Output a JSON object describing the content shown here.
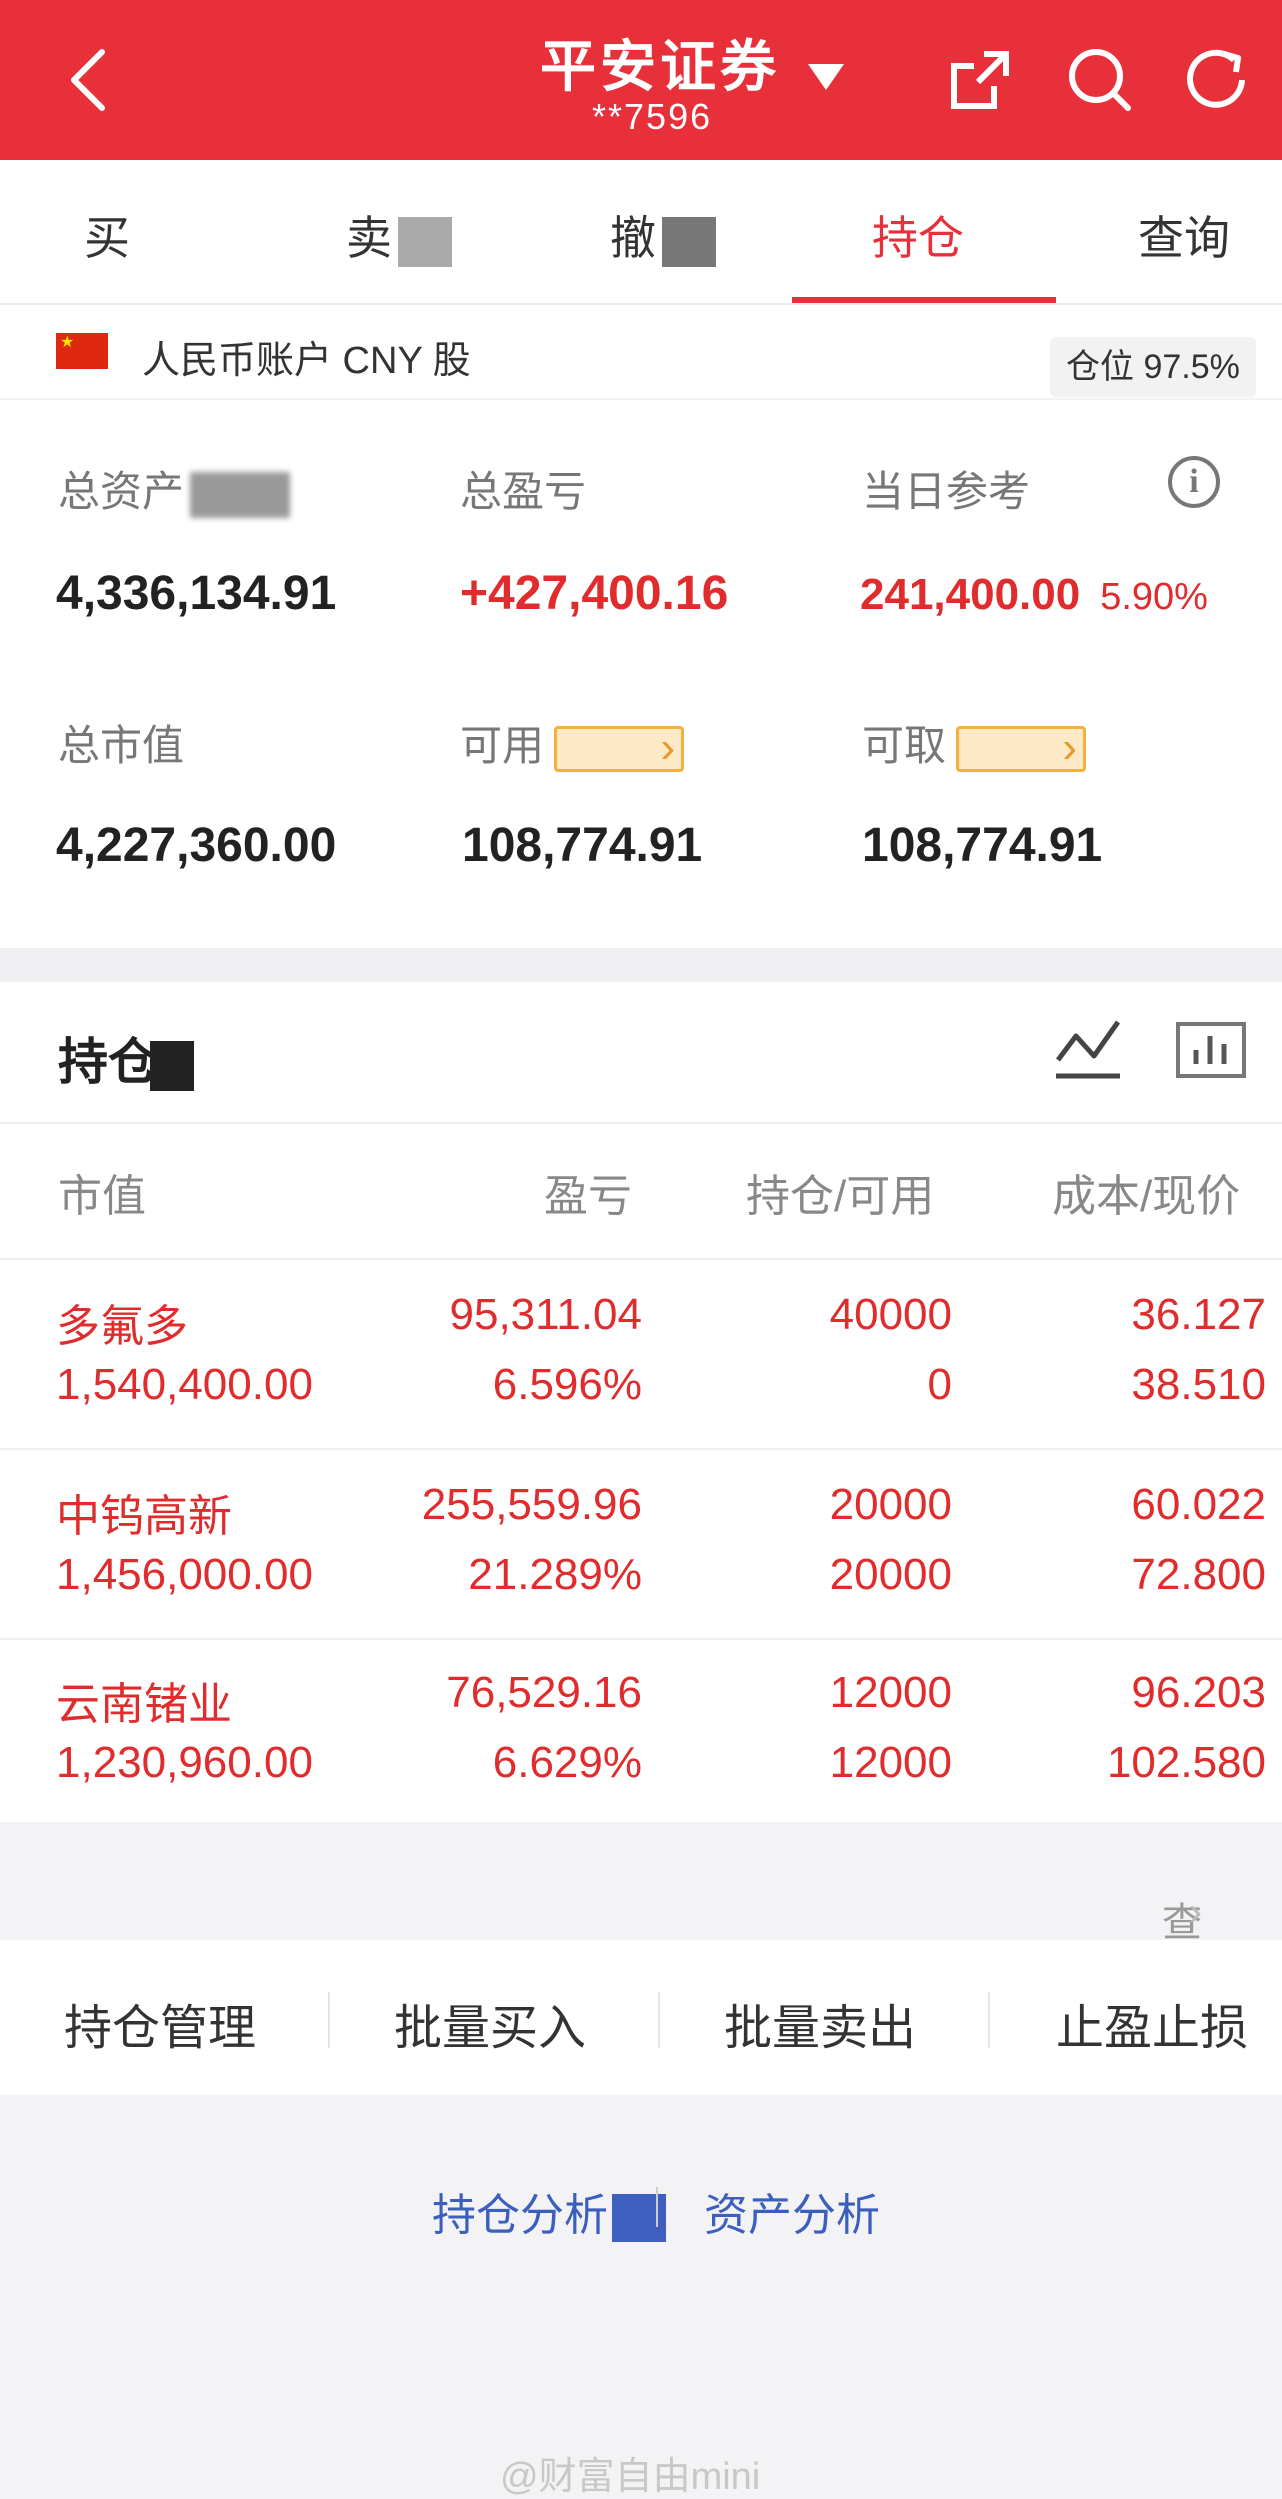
{
  "header": {
    "title": "平安证券",
    "account": "**7596"
  },
  "tabs": [
    {
      "label": "买"
    },
    {
      "label": "卖"
    },
    {
      "label": "撤"
    },
    {
      "label": "持仓"
    },
    {
      "label": "查询"
    }
  ],
  "account_bar": {
    "label": "人民币账户 CNY 股",
    "position": "仓位 97.5%"
  },
  "summary": {
    "total_assets_label": "总资产",
    "total_assets": "4,336,134.91",
    "total_pnl_label": "总盈亏",
    "total_pnl": "+427,400.16",
    "daily_pnl_label": "当日参考",
    "daily_pnl": "241,400.00",
    "daily_pnl_pct": "5.90%",
    "market_value_label": "总市值",
    "market_value": "4,227,360.00",
    "available_label": "可用",
    "available": "108,774.91",
    "withdrawable_label": "可取",
    "withdrawable": "108,774.91"
  },
  "holdings": {
    "title": "持仓",
    "columns": [
      "市值",
      "盈亏",
      "持仓/可用",
      "成本/现价"
    ],
    "rows": [
      {
        "name": "多氟多",
        "market_value": "1,540,400.00",
        "pnl": "95,311.04",
        "pnl_pct": "6.596%",
        "qty": "40000",
        "available": "0",
        "cost": "36.127",
        "price": "38.510"
      },
      {
        "name": "中钨高新",
        "market_value": "1,456,000.00",
        "pnl": "255,559.96",
        "pnl_pct": "21.289%",
        "qty": "20000",
        "available": "20000",
        "cost": "60.022",
        "price": "72.800"
      },
      {
        "name": "云南锗业",
        "market_value": "1,230,960.00",
        "pnl": "76,529.16",
        "pnl_pct": "6.629%",
        "qty": "12000",
        "available": "12000",
        "cost": "96.203",
        "price": "102.580"
      }
    ]
  },
  "cleared_link": "查看已清仓股票",
  "actions": [
    "持仓管理",
    "批量买入",
    "批量卖出",
    "止盈止损"
  ],
  "footer_links": [
    "持仓分析",
    "资产分析"
  ],
  "watermark": "@财富自由mini"
}
